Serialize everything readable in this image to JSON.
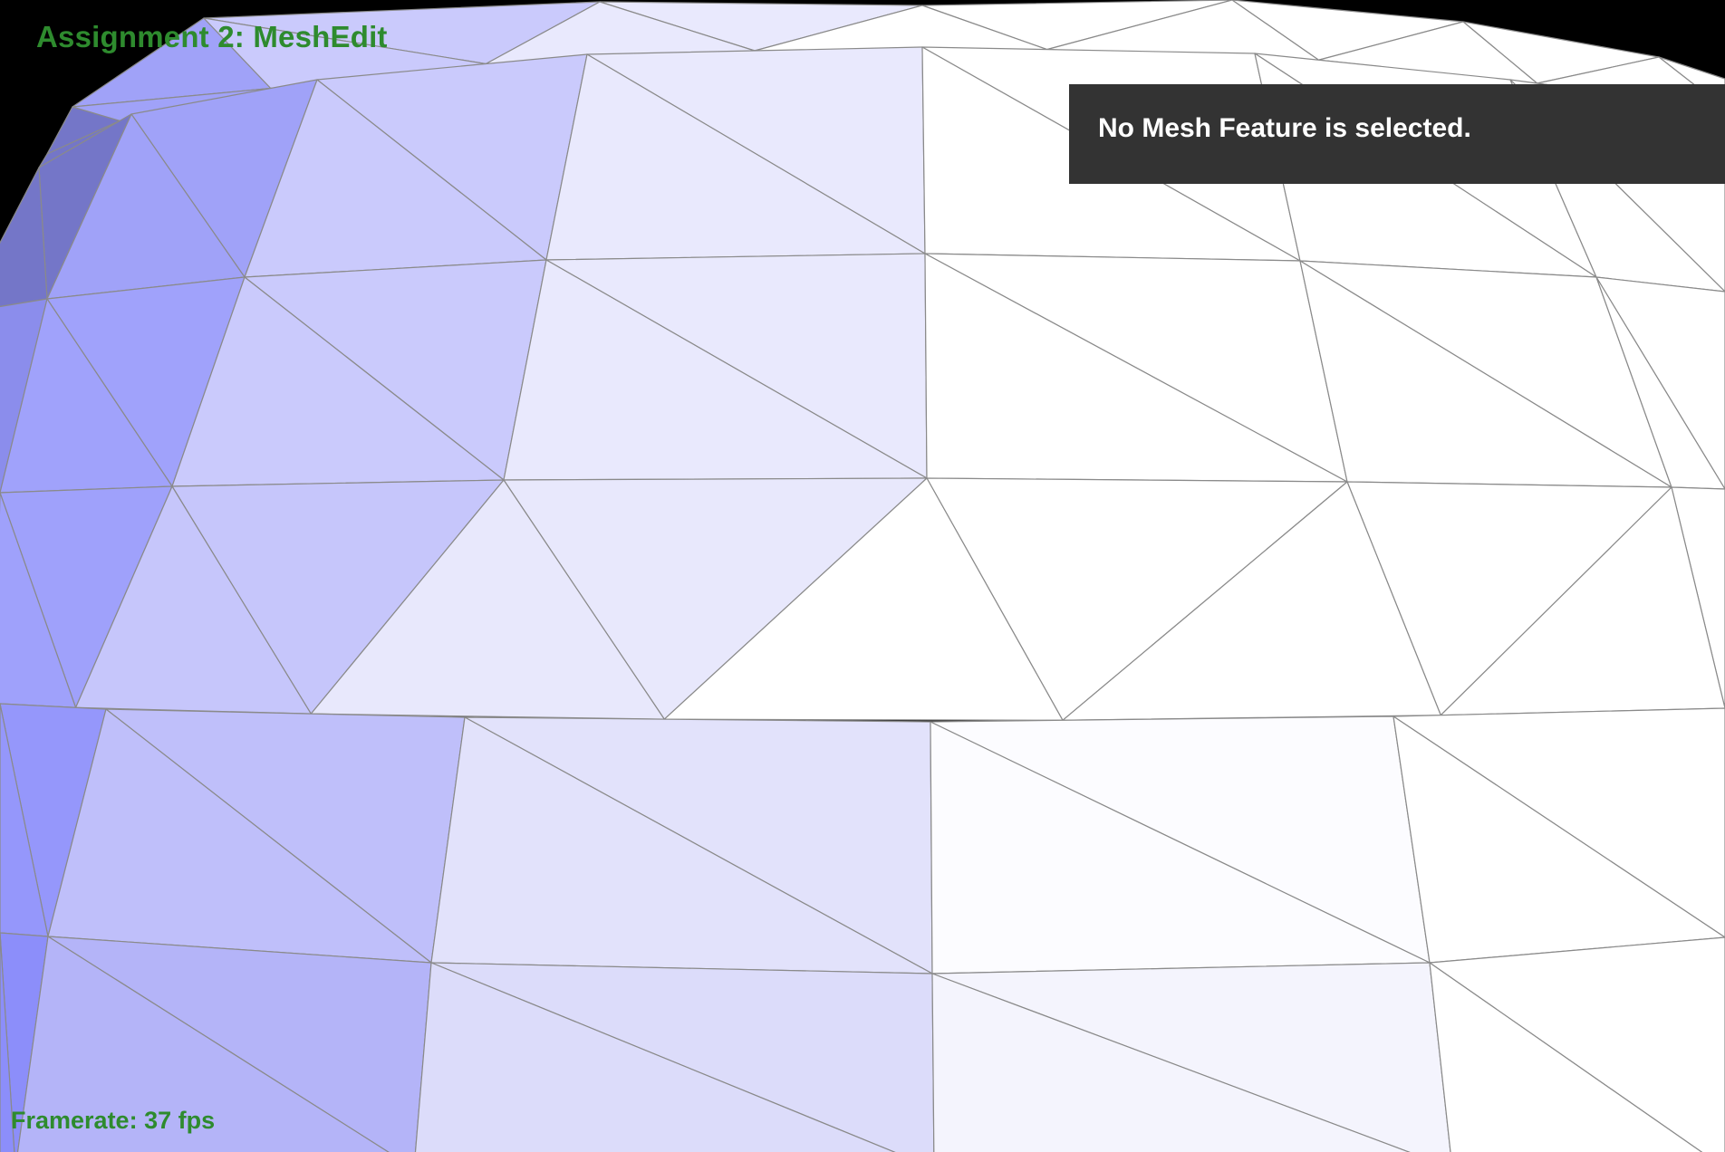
{
  "window": {
    "title": "Assignment 2: MeshEdit"
  },
  "status": {
    "framerate": "Framerate: 37 fps"
  },
  "info_panel": {
    "message": "No Mesh Feature is selected."
  },
  "colors": {
    "background": "#000000",
    "overlay_text": "#2e8b2e",
    "panel_background": "#333333",
    "panel_text": "#ffffff",
    "mesh_edge": "#8a8a8a"
  }
}
